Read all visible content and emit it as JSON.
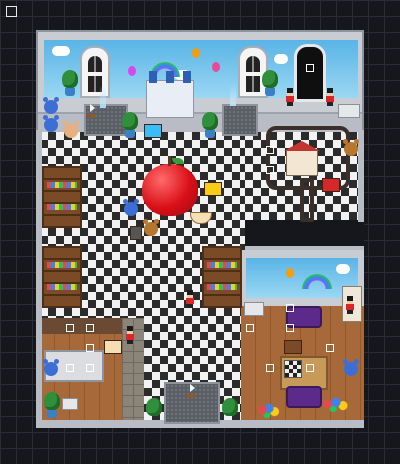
{
  "hud": {
    "menu_icon": "menu-box-icon"
  },
  "scene": {
    "type": "top-down toy shop map",
    "colors": {
      "floor_dark": "#2b2b2b",
      "floor_light": "#f2f2f2",
      "wall": "#c9ccd3",
      "sky": "#59b4e6",
      "wood": "#a8693a",
      "apple": "#d90f18",
      "void": "#16171c"
    }
  },
  "markers": [
    {
      "id": "door-marker"
    },
    {
      "id": "track-marker-1"
    },
    {
      "id": "track-marker-2"
    },
    {
      "id": "left-room-marker-1"
    },
    {
      "id": "left-room-marker-2"
    },
    {
      "id": "left-room-marker-3"
    },
    {
      "id": "left-room-marker-4"
    },
    {
      "id": "left-room-marker-5"
    },
    {
      "id": "right-room-marker-1"
    },
    {
      "id": "right-room-marker-2"
    },
    {
      "id": "right-room-marker-3"
    },
    {
      "id": "right-room-marker-4"
    },
    {
      "id": "right-room-marker-5"
    },
    {
      "id": "right-room-marker-6"
    }
  ]
}
